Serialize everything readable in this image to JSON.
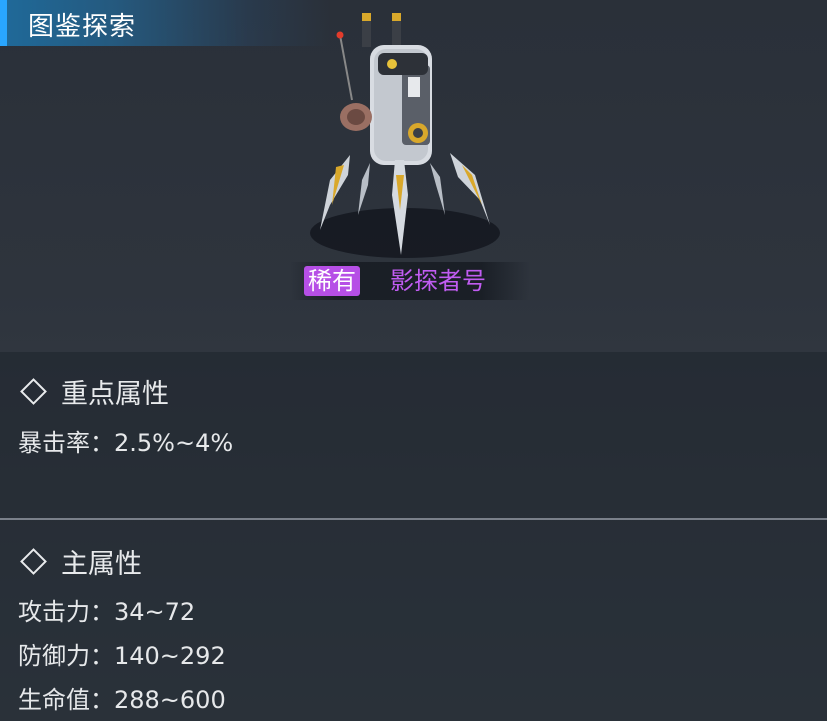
{
  "header": {
    "title": "图鉴探索"
  },
  "unit": {
    "rarity": "稀有",
    "name": "影探者号"
  },
  "colors": {
    "accent_blue": "#29a6ff",
    "rarity_purple": "#b64fe6",
    "name_purple": "#c15cf2"
  },
  "key_attributes": {
    "title": "重点属性",
    "stats": [
      {
        "text": "暴击率：2.5%~4%"
      }
    ]
  },
  "main_attributes": {
    "title": "主属性",
    "stats": [
      {
        "text": "攻击力：34~72"
      },
      {
        "text": "防御力：140~292"
      },
      {
        "text": "生命值：288~600"
      }
    ]
  }
}
